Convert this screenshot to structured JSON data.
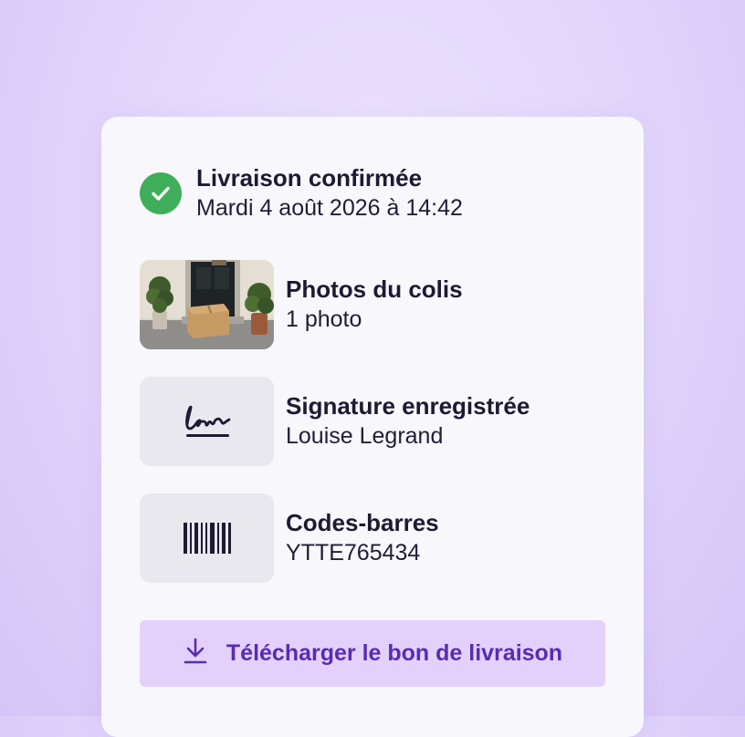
{
  "status": {
    "icon": "check-circle-icon",
    "title": "Livraison confirmée",
    "datetime": "Mardi 4 août 2026 à 14:42"
  },
  "items": [
    {
      "icon": "package-photo-thumbnail",
      "title": "Photos du colis",
      "detail": "1 photo"
    },
    {
      "icon": "signature-icon",
      "title": "Signature enregistrée",
      "detail": "Louise Legrand"
    },
    {
      "icon": "barcode-icon",
      "title": "Codes-barres",
      "detail": "YTTE765434"
    }
  ],
  "download_button": {
    "icon": "download-icon",
    "label": "Télécharger le bon de livraison"
  },
  "colors": {
    "accent": "#5a2bb3",
    "button_bg": "#e3d1fb",
    "success": "#3fae5a"
  }
}
